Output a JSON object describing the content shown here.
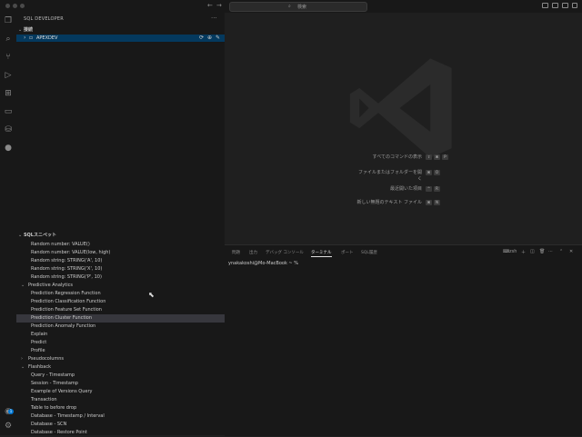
{
  "titlebar": {
    "search_placeholder": "検索",
    "search_icon": "search-icon",
    "nav_back": "←",
    "nav_forward": "→"
  },
  "activity": {
    "icons": [
      "files-icon",
      "search-icon",
      "source-control-icon",
      "run-debug-icon",
      "extensions-icon",
      "remote-explorer-icon",
      "database-icon",
      "github-icon"
    ],
    "account_badge": "1"
  },
  "sidebar": {
    "title": "SQL DEVELOPER",
    "more": "···",
    "connections_header": "接続",
    "connection": {
      "name": "APEXDEV",
      "tools": "⟳ ⊕ ✎"
    },
    "snippets_header": "SQLスニペット",
    "items": [
      {
        "label": "Random number: VALUE()",
        "kind": "leaf"
      },
      {
        "label": "Random number: VALUE(low, high)",
        "kind": "leaf"
      },
      {
        "label": "Random string: STRING('A', 10)",
        "kind": "leaf"
      },
      {
        "label": "Random string: STRING('X', 10)",
        "kind": "leaf"
      },
      {
        "label": "Random string: STRING('P', 10)",
        "kind": "leaf"
      },
      {
        "label": "Predictive Analytics",
        "kind": "open"
      },
      {
        "label": "Prediction Regression Function",
        "kind": "leaf"
      },
      {
        "label": "Prediction Classification Function",
        "kind": "leaf"
      },
      {
        "label": "Prediction Feature Set Function",
        "kind": "leaf"
      },
      {
        "label": "Prediction Cluster Function",
        "kind": "leaf",
        "selected": true
      },
      {
        "label": "Prediction Anomaly Function",
        "kind": "leaf"
      },
      {
        "label": "Explain",
        "kind": "leaf"
      },
      {
        "label": "Predict",
        "kind": "leaf"
      },
      {
        "label": "Profile",
        "kind": "leaf"
      },
      {
        "label": "Pseudocolumns",
        "kind": "closed"
      },
      {
        "label": "Flashback",
        "kind": "open"
      },
      {
        "label": "Query - Timestamp",
        "kind": "leaf"
      },
      {
        "label": "Session - Timestamp",
        "kind": "leaf"
      },
      {
        "label": "Example of Versions Query",
        "kind": "leaf"
      },
      {
        "label": "Transaction",
        "kind": "leaf"
      },
      {
        "label": "Table to before drop",
        "kind": "leaf"
      },
      {
        "label": "Database - Timestamp / Interval",
        "kind": "leaf"
      },
      {
        "label": "Database - SCN",
        "kind": "leaf"
      },
      {
        "label": "Database - Restore Point",
        "kind": "leaf"
      }
    ]
  },
  "editor": {
    "shortcuts": [
      {
        "label": "すべてのコマンドの表示",
        "keys": [
          "⇧",
          "⌘",
          "P"
        ]
      },
      {
        "label": "ファイルまたはフォルダーを開く",
        "keys": [
          "⌘",
          "O"
        ]
      },
      {
        "label": "最近開いた項目",
        "keys": [
          "^",
          "R"
        ]
      },
      {
        "label": "新しい無題のテキスト ファイル",
        "keys": [
          "⌘",
          "N"
        ]
      }
    ]
  },
  "panel": {
    "tabs": [
      "問題",
      "出力",
      "デバッグ コンソール",
      "ターミナル",
      "ポート",
      "SQL履歴"
    ],
    "active_tab": "ターミナル",
    "terminal_name": "zsh",
    "prompt": "ynakakoshi@Mo-MacBook ~ %"
  },
  "colors": {
    "background": "#1f1f1f",
    "sidebar": "#181818",
    "selection": "#37373d",
    "connection_highlight": "#04395e"
  }
}
